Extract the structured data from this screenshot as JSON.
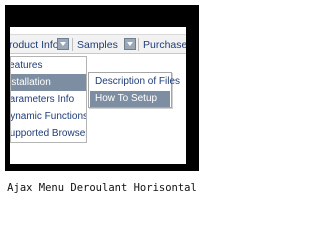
{
  "menubar": {
    "items": [
      {
        "label": "Product Info"
      },
      {
        "label": "Samples"
      },
      {
        "label": "Purchase"
      }
    ]
  },
  "submenu": {
    "items": [
      {
        "label": "Features"
      },
      {
        "label": "Installation"
      },
      {
        "label": "Parameters Info"
      },
      {
        "label": "Dynamic Functions"
      },
      {
        "label": "Supported Browsers"
      }
    ]
  },
  "subsubmenu": {
    "items": [
      {
        "label": "Description of Files"
      },
      {
        "label": "How To Setup"
      }
    ]
  },
  "caption": "Ajax Menu Deroulant Horisontal",
  "colors": {
    "frame": "#000000",
    "menu_text": "#1f3d78",
    "highlight": "#7e8ea2"
  }
}
